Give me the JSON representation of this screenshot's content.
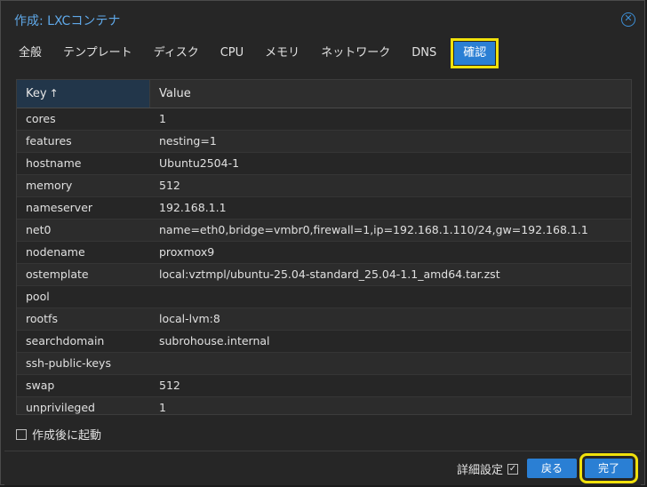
{
  "window": {
    "title": "作成: LXCコンテナ",
    "close_icon": "close-circle-icon"
  },
  "tabs": [
    {
      "label": "全般"
    },
    {
      "label": "テンプレート"
    },
    {
      "label": "ディスク"
    },
    {
      "label": "CPU"
    },
    {
      "label": "メモリ"
    },
    {
      "label": "ネットワーク"
    },
    {
      "label": "DNS"
    },
    {
      "label": "確認",
      "active": true
    }
  ],
  "grid": {
    "header_key": "Key",
    "header_value": "Value",
    "sort_icon": "↑",
    "rows": [
      {
        "key": "cores",
        "value": "1"
      },
      {
        "key": "features",
        "value": "nesting=1"
      },
      {
        "key": "hostname",
        "value": "Ubuntu2504-1"
      },
      {
        "key": "memory",
        "value": "512"
      },
      {
        "key": "nameserver",
        "value": "192.168.1.1"
      },
      {
        "key": "net0",
        "value": "name=eth0,bridge=vmbr0,firewall=1,ip=192.168.1.110/24,gw=192.168.1.1"
      },
      {
        "key": "nodename",
        "value": "proxmox9"
      },
      {
        "key": "ostemplate",
        "value": "local:vztmpl/ubuntu-25.04-standard_25.04-1.1_amd64.tar.zst"
      },
      {
        "key": "pool",
        "value": ""
      },
      {
        "key": "rootfs",
        "value": "local-lvm:8"
      },
      {
        "key": "searchdomain",
        "value": "subrohouse.internal"
      },
      {
        "key": "ssh-public-keys",
        "value": ""
      },
      {
        "key": "swap",
        "value": "512"
      },
      {
        "key": "unprivileged",
        "value": "1"
      }
    ]
  },
  "start_after_create": {
    "label": "作成後に起動",
    "checked": false
  },
  "footer": {
    "advanced_label": "詳細設定",
    "advanced_checked": true,
    "back_label": "戻る",
    "finish_label": "完了"
  }
}
